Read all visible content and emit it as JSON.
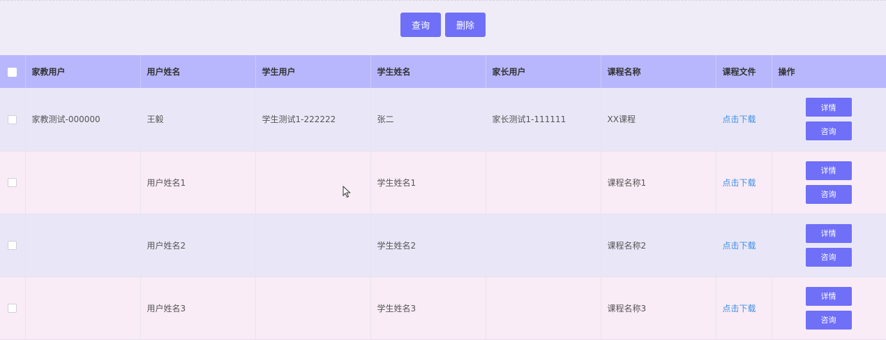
{
  "toolbar": {
    "query_label": "查询",
    "delete_label": "删除"
  },
  "table": {
    "headers": [
      "家教用户",
      "用户姓名",
      "学生用户",
      "学生姓名",
      "家长用户",
      "课程名称",
      "课程文件",
      "操作"
    ],
    "rows": [
      {
        "tutor_user": "家教测试-000000",
        "user_name": "王毅",
        "student_user": "学生测试1-222222",
        "student_name": "张二",
        "parent_user": "家长测试1-111111",
        "course_name": "XX课程",
        "course_file": "点击下载",
        "detail_label": "详情",
        "consult_label": "咨询"
      },
      {
        "tutor_user": "",
        "user_name": "用户姓名1",
        "student_user": "",
        "student_name": "学生姓名1",
        "parent_user": "",
        "course_name": "课程名称1",
        "course_file": "点击下载",
        "detail_label": "详情",
        "consult_label": "咨询"
      },
      {
        "tutor_user": "",
        "user_name": "用户姓名2",
        "student_user": "",
        "student_name": "学生姓名2",
        "parent_user": "",
        "course_name": "课程名称2",
        "course_file": "点击下载",
        "detail_label": "详情",
        "consult_label": "咨询"
      },
      {
        "tutor_user": "",
        "user_name": "用户姓名3",
        "student_user": "",
        "student_name": "学生姓名3",
        "parent_user": "",
        "course_name": "课程名称3",
        "course_file": "点击下载",
        "detail_label": "详情",
        "consult_label": "咨询"
      }
    ]
  },
  "colors": {
    "button": "#6f6ff8",
    "header": "#b8b7fd",
    "link": "#3e8fe6",
    "row_even": "#e9e7f7",
    "row_odd": "#f9ecf6"
  }
}
